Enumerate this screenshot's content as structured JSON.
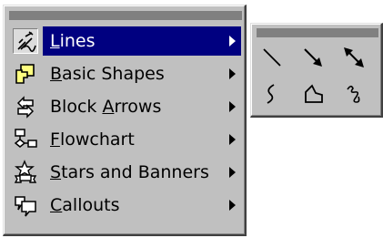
{
  "menu": {
    "items": [
      {
        "label_parts": [
          "",
          "L",
          "ines"
        ],
        "icon": "lines-icon",
        "active": true
      },
      {
        "label_parts": [
          "",
          "B",
          "asic Shapes"
        ],
        "icon": "basic-shapes-icon",
        "active": false
      },
      {
        "label_parts": [
          "Block ",
          "A",
          "rrows"
        ],
        "icon": "block-arrows-icon",
        "active": false
      },
      {
        "label_parts": [
          "",
          "F",
          "lowchart"
        ],
        "icon": "flowchart-icon",
        "active": false
      },
      {
        "label_parts": [
          "",
          "S",
          "tars and Banners"
        ],
        "icon": "stars-and-banners-icon",
        "active": false
      },
      {
        "label_parts": [
          "",
          "C",
          "allouts"
        ],
        "icon": "callouts-icon",
        "active": false
      }
    ]
  },
  "submenu": {
    "tools": [
      "line-icon",
      "arrow-icon",
      "double-arrow-icon",
      "curve-icon",
      "freeform-icon",
      "scribble-icon"
    ]
  },
  "colors": {
    "highlight": "#000080",
    "face": "#c0c0c0",
    "titlebar": "#808080"
  }
}
